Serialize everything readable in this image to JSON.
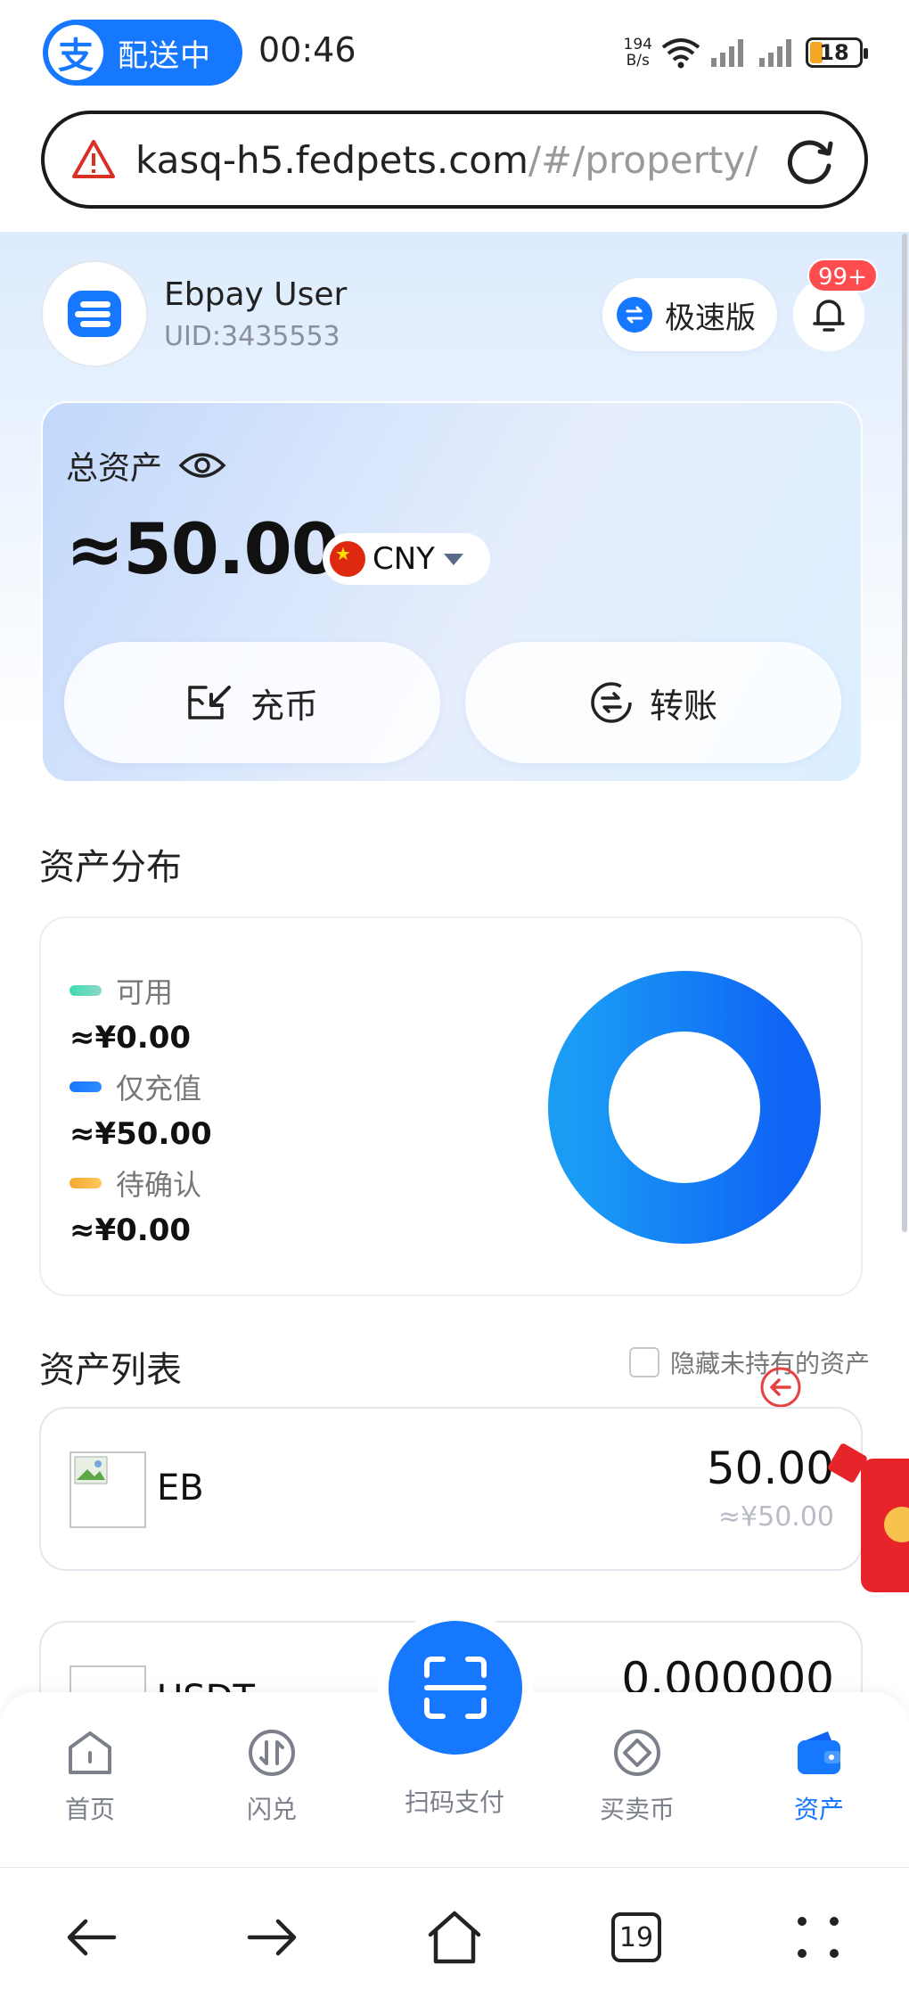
{
  "status_bar": {
    "app_pill_icon": "支",
    "app_pill_text": "配送中",
    "time": "00:46",
    "net_speed_value": "194",
    "net_speed_unit": "B/s",
    "battery": "18"
  },
  "url_bar": {
    "url_main": "kasq-h5.fedpets.com",
    "url_rest": "/#/property/a"
  },
  "header": {
    "user_name": "Ebpay User",
    "uid": "UID:3435553",
    "speed_label": "极速版",
    "notify_badge": "99+"
  },
  "asset_card": {
    "title": "总资产",
    "amount": "≈50.00",
    "currency": "CNY",
    "deposit_label": "充币",
    "transfer_label": "转账"
  },
  "distribution": {
    "title": "资产分布",
    "items": [
      {
        "label": "可用",
        "value": "≈¥0.00",
        "color": "#4fd1b5",
        "amount": 0
      },
      {
        "label": "仅充值",
        "value": "≈¥50.00",
        "color": "#1677ff",
        "amount": 50
      },
      {
        "label": "待确认",
        "value": "≈¥0.00",
        "color": "#f7b733",
        "amount": 0
      }
    ]
  },
  "asset_list": {
    "title": "资产列表",
    "hide_label": "隐藏未持有的资产",
    "rows": [
      {
        "name": "EB",
        "amount": "50.00",
        "cny": "≈¥50.00"
      },
      {
        "name": "USDT",
        "amount": "0.000000",
        "cny": ""
      }
    ]
  },
  "tabbar": {
    "items": [
      {
        "label": "首页",
        "icon": "home-icon"
      },
      {
        "label": "闪兑",
        "icon": "swap-icon"
      },
      {
        "label": "扫码支付",
        "icon": "scan-icon"
      },
      {
        "label": "买卖币",
        "icon": "trade-icon"
      },
      {
        "label": "资产",
        "icon": "wallet-icon"
      }
    ],
    "active_color": "#1677ff"
  },
  "system_nav": {
    "tab_count": "19"
  }
}
